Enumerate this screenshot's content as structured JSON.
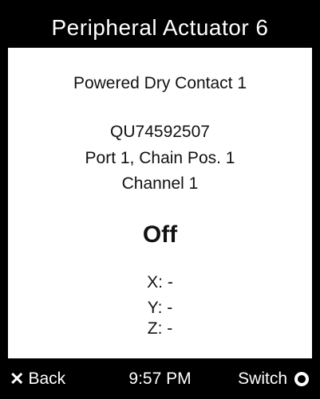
{
  "header": {
    "title": "Peripheral Actuator 6"
  },
  "device": {
    "name": "Powered Dry Contact 1",
    "serial": "QU74592507",
    "location": "Port 1, Chain Pos. 1",
    "channel": "Channel 1",
    "state": "Off"
  },
  "coordinates": {
    "x": "X: -",
    "y": "Y: -",
    "z": "Z: -"
  },
  "footer": {
    "back_label": "Back",
    "time": "9:57 PM",
    "switch_label": "Switch",
    "back_icon": "x-icon",
    "switch_icon": "circle-icon"
  }
}
